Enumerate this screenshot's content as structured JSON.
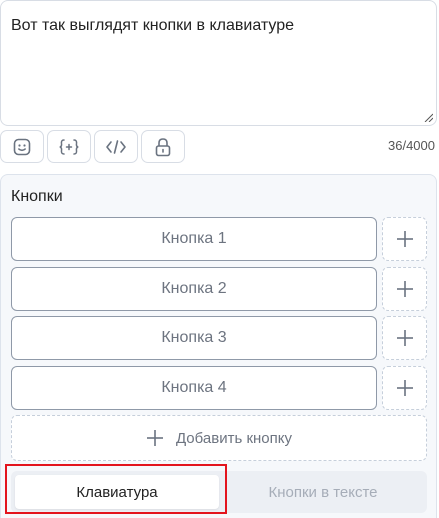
{
  "editor": {
    "text": "Вот так выглядят кнопки в клавиатуре"
  },
  "toolbar": {
    "tools": [
      {
        "icon": "emoji-icon"
      },
      {
        "icon": "variable-braces-icon"
      },
      {
        "icon": "code-icon"
      },
      {
        "icon": "lock-icon"
      }
    ],
    "counter": "36/4000"
  },
  "panel": {
    "title": "Кнопки",
    "buttons": [
      {
        "label": "Кнопка 1"
      },
      {
        "label": "Кнопка 2"
      },
      {
        "label": "Кнопка 3"
      },
      {
        "label": "Кнопка 4"
      }
    ],
    "add_button_label": "Добавить кнопку",
    "mode_tabs": {
      "keyboard": "Клавиатура",
      "inline": "Кнопки в тексте",
      "selected": "keyboard"
    }
  },
  "colors": {
    "highlight": "#e3141d",
    "border": "#8f99a8",
    "muted_text": "#6d7480"
  }
}
